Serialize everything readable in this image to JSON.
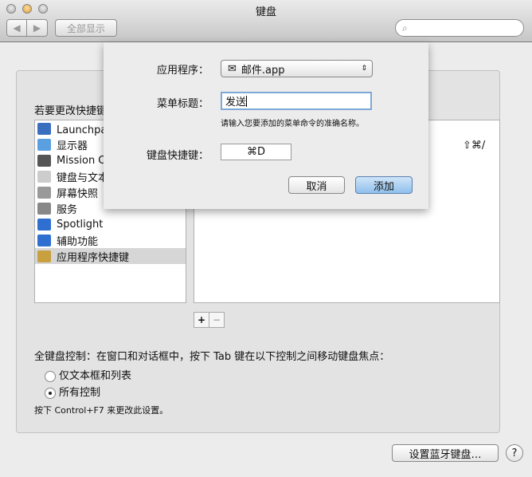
{
  "window": {
    "title": "键盘"
  },
  "toolbar": {
    "back": "◀",
    "forward": "▶",
    "show_all": "全部显示",
    "search_placeholder": ""
  },
  "panel": {
    "instruction": "若要更改快捷键",
    "categories": [
      {
        "label": "Launchpad 与 Dock",
        "icon": "launchpad-icon",
        "color": "#3a6fc0"
      },
      {
        "label": "显示器",
        "icon": "display-icon",
        "color": "#5aa0e0"
      },
      {
        "label": "Mission Control",
        "icon": "mission-control-icon",
        "color": "#555"
      },
      {
        "label": "键盘与文本输入",
        "icon": "keyboard-icon",
        "color": "#ccc"
      },
      {
        "label": "屏幕快照",
        "icon": "screenshot-icon",
        "color": "#999"
      },
      {
        "label": "服务",
        "icon": "gear-icon",
        "color": "#888"
      },
      {
        "label": "Spotlight",
        "icon": "spotlight-icon",
        "color": "#2f6fd0"
      },
      {
        "label": "辅助功能",
        "icon": "accessibility-icon",
        "color": "#2f6fd0"
      },
      {
        "label": "应用程序快捷键",
        "icon": "app-shortcuts-icon",
        "color": "#c8a040",
        "selected": true
      }
    ],
    "shortcut_row": {
      "checked": "✓",
      "shortcut": "⇧⌘/"
    },
    "add": "+",
    "remove": "−",
    "full_kb_label": "全键盘控制：在窗口和对话框中，按下 Tab 键在以下控制之间移动键盘焦点：",
    "radio_options": [
      {
        "label": "仅文本框和列表",
        "selected": false
      },
      {
        "label": "所有控制",
        "selected": true
      }
    ],
    "hint": "按下 Control+F7 来更改此设置。",
    "bluetooth_button": "设置蓝牙键盘…",
    "help": "?"
  },
  "sheet": {
    "app_label": "应用程序：",
    "app_value": "邮件.app",
    "menu_label": "菜单标题：",
    "menu_value": "发送",
    "menu_hint": "请输入您要添加的菜单命令的准确名称。",
    "shortcut_label": "键盘快捷键：",
    "shortcut_value": "⌘D",
    "cancel": "取消",
    "add": "添加"
  },
  "colors": {
    "accent": "#8fc0ec"
  }
}
